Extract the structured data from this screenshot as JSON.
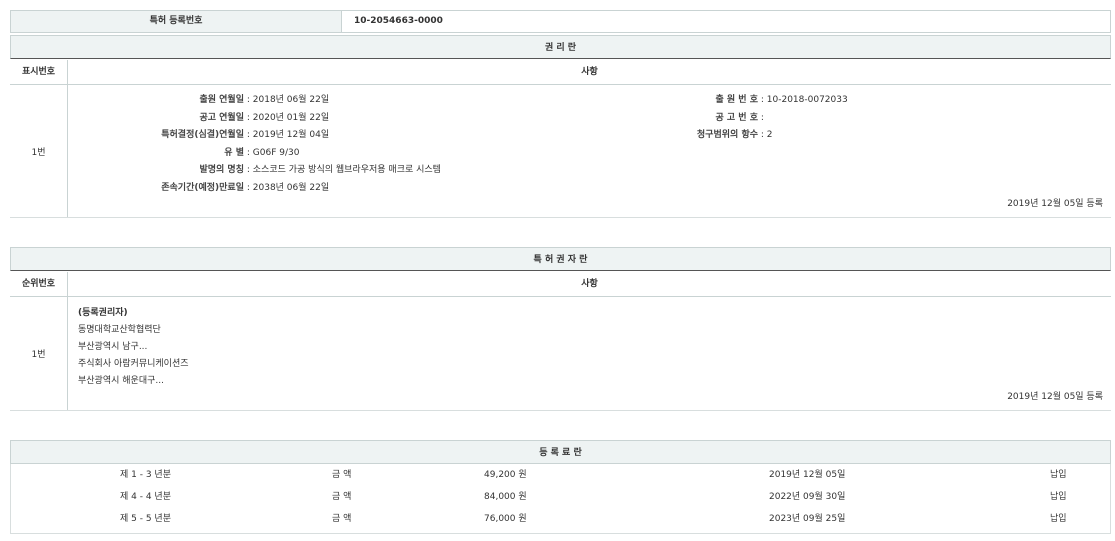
{
  "registration": {
    "label": "특허 등록번호",
    "number": "10-2054663-0000"
  },
  "rights": {
    "title": "권 리 란",
    "col_no": "표시번호",
    "col_item": "사항",
    "row_no": "1번",
    "filing_date_label": "출원 연월일",
    "filing_date": "2018년 06월 22일",
    "pub_date_label": "공고 연월일",
    "pub_date": "2020년 01월 22일",
    "decision_date_label": "특허결정(심결)연월일",
    "decision_date": "2019년 12월 04일",
    "class_label": "유 별",
    "class": "G06F 9/30",
    "invention_label": "발명의 명칭",
    "invention": "소스코드 가공 방식의 웹브라우저용 매크로 시스템",
    "expiry_label": "존속기간(예정)만료일",
    "expiry": "2038년 06월 22일",
    "app_no_label": "출 원 번 호",
    "app_no": "10-2018-0072033",
    "pub_no_label": "공 고 번 호",
    "pub_no": "",
    "claims_label": "청구범위의 항수",
    "claims": "2",
    "registered": "2019년 12월 05일 등록"
  },
  "holders": {
    "title": "특 허 권 자 란",
    "col_no": "순위번호",
    "col_item": "사항",
    "row_no": "1번",
    "lines": [
      "(등록권리자)",
      "동명대학교산학협력단",
      "부산광역시 남구...",
      "주식회사 아람커뮤니케이션즈",
      "부산광역시 해운대구..."
    ],
    "registered": "2019년 12월 05일 등록"
  },
  "fees": {
    "title": "등 록 료 란",
    "rows": [
      {
        "period": "제 1 - 3 년분",
        "amount_label": "금 액",
        "amount": "49,200 원",
        "date": "2019년 12월 05일",
        "status": "납입"
      },
      {
        "period": "제 4 - 4 년분",
        "amount_label": "금 액",
        "amount": "84,000 원",
        "date": "2022년 09월 30일",
        "status": "납입"
      },
      {
        "period": "제 5 - 5 년분",
        "amount_label": "금 액",
        "amount": "76,000 원",
        "date": "2023년 09월 25일",
        "status": "납입"
      }
    ]
  }
}
